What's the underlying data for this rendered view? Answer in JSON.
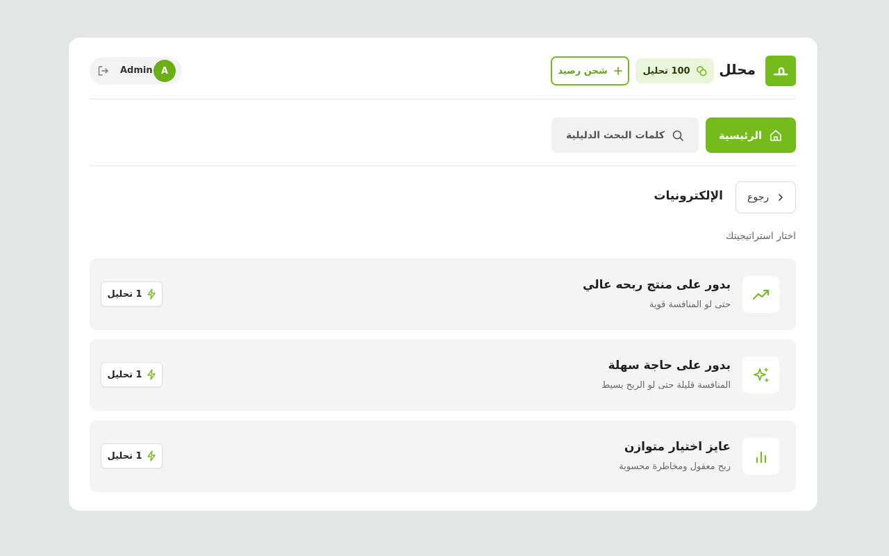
{
  "colors": {
    "brand": "#74bc1b",
    "brand_light": "#eaf6dc",
    "background": "#e3e6e7"
  },
  "header": {
    "logo_icon": "logo-mark",
    "brand_name": "محلل",
    "credits": {
      "icon": "coins-icon",
      "text": "100 تحليل"
    },
    "topup": {
      "icon": "plus-icon",
      "label": "شحن رصيد"
    },
    "user": {
      "name": "Admin",
      "avatar_initial": "A",
      "logout_icon": "logout-icon"
    }
  },
  "nav": {
    "home": {
      "icon": "home-icon",
      "label": "الرئيسية"
    },
    "keywords": {
      "icon": "search-icon",
      "label": "كلمات البحث الدليلية"
    }
  },
  "page": {
    "back_label": "رجوع",
    "title": "الإلكترونيات",
    "section_label": "اختار استراتيجيتك"
  },
  "strategies": [
    {
      "icon": "trending-up-icon",
      "title": "بدور على منتج ربحه عالي",
      "subtitle": "حتى لو المنافسة قوية",
      "cost": "1 تحليل"
    },
    {
      "icon": "sparkles-icon",
      "title": "بدور على حاجة سهلة",
      "subtitle": "المنافسة قليلة حتى لو الربح بسيط",
      "cost": "1 تحليل"
    },
    {
      "icon": "bar-chart-icon",
      "title": "عايز اختيار متوازن",
      "subtitle": "ربح معقول ومخاطرة محسوبة",
      "cost": "1 تحليل"
    }
  ]
}
